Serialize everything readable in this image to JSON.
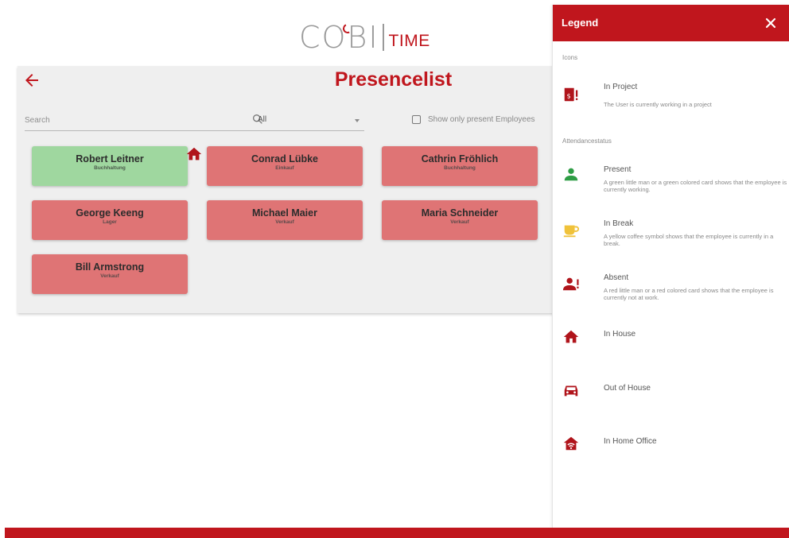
{
  "brand": {
    "name_left": "CO",
    "name_right": "BI",
    "name_suffix": "TIME",
    "accent_color": "#c0161d"
  },
  "page": {
    "title": "Presencelist",
    "back_icon": "arrow-left-icon"
  },
  "filters": {
    "search_placeholder": "Search",
    "search_icon": "search-icon",
    "group_select_value": "All",
    "present_only_label": "Show only present Employees"
  },
  "employees": [
    {
      "name": "Robert Leitner",
      "department": "Buchhaltung",
      "status": "present"
    },
    {
      "name": "Conrad Lübke",
      "department": "Einkauf",
      "status": "absent"
    },
    {
      "name": "Cathrin Fröhlich",
      "department": "Buchhaltung",
      "status": "absent"
    },
    {
      "name": "George Keeng",
      "department": "Lager",
      "status": "absent"
    },
    {
      "name": "Michael Maier",
      "department": "Verkauf",
      "status": "absent"
    },
    {
      "name": "Maria Schneider",
      "department": "Verkauf",
      "status": "absent"
    },
    {
      "name": "Bill Armstrong",
      "department": "Verkauf",
      "status": "absent"
    }
  ],
  "status_colors": {
    "present": "#9fd79f",
    "absent": "#df7475"
  },
  "legend": {
    "title": "Legend",
    "close_icon": "close-icon",
    "icons_heading": "Icons",
    "attendance_heading": "Attendancestatus",
    "items": [
      {
        "icon": "project-icon",
        "label": "In Project",
        "description": "The User is currently working in a project"
      },
      {
        "icon": "person-present-icon",
        "label": "Present",
        "description": "A green little man or a green colored card shows that the employee is currently working."
      },
      {
        "icon": "coffee-icon",
        "label": "In Break",
        "description": "A yellow coffee symbol shows that the employee is currently in a break."
      },
      {
        "icon": "person-absent-icon",
        "label": "Absent",
        "description": "A red little man or a red colored card shows that the employee is currently not at work."
      },
      {
        "icon": "house-icon",
        "label": "In House",
        "description": ""
      },
      {
        "icon": "car-icon",
        "label": "Out of House",
        "description": ""
      },
      {
        "icon": "home-office-icon",
        "label": "In Home Office",
        "description": ""
      }
    ]
  }
}
